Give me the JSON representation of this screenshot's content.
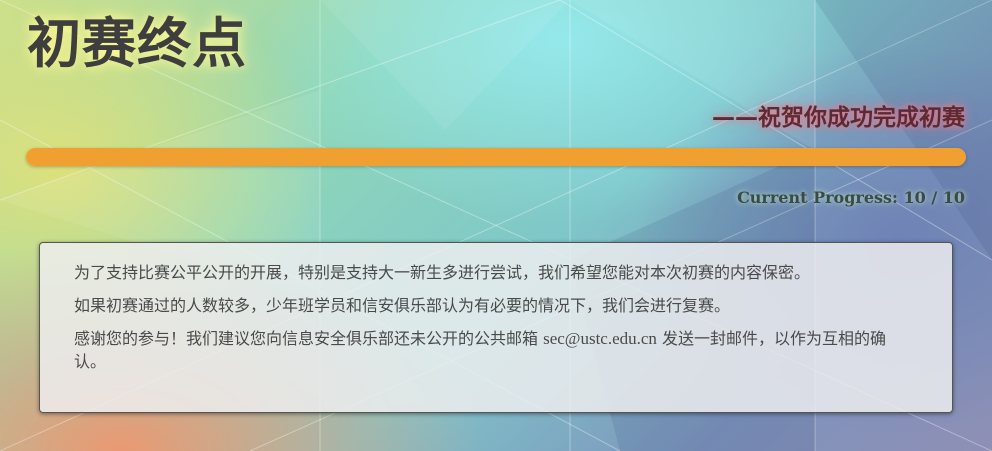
{
  "header": {
    "title": "初赛终点",
    "subtitle": "——祝贺你成功完成初赛"
  },
  "progress": {
    "label": "Current Progress: 10 / 10",
    "current": 10,
    "total": 10,
    "fraction": 1.0,
    "color": "#f0a030"
  },
  "message": {
    "p1": "为了支持比赛公平公开的开展，特别是支持大一新生多进行尝试，我们希望您能对本次初赛的内容保密。",
    "p2": "如果初赛通过的人数较多，少年班学员和信安俱乐部认为有必要的情况下，我们会进行复赛。",
    "p3_before": "感谢您的参与！我们建议您向信息安全俱乐部还未公开的公共邮箱 ",
    "email": "sec@ustc.edu.cn",
    "p3_after": " 发送一封邮件，以作为互相的确认。"
  }
}
